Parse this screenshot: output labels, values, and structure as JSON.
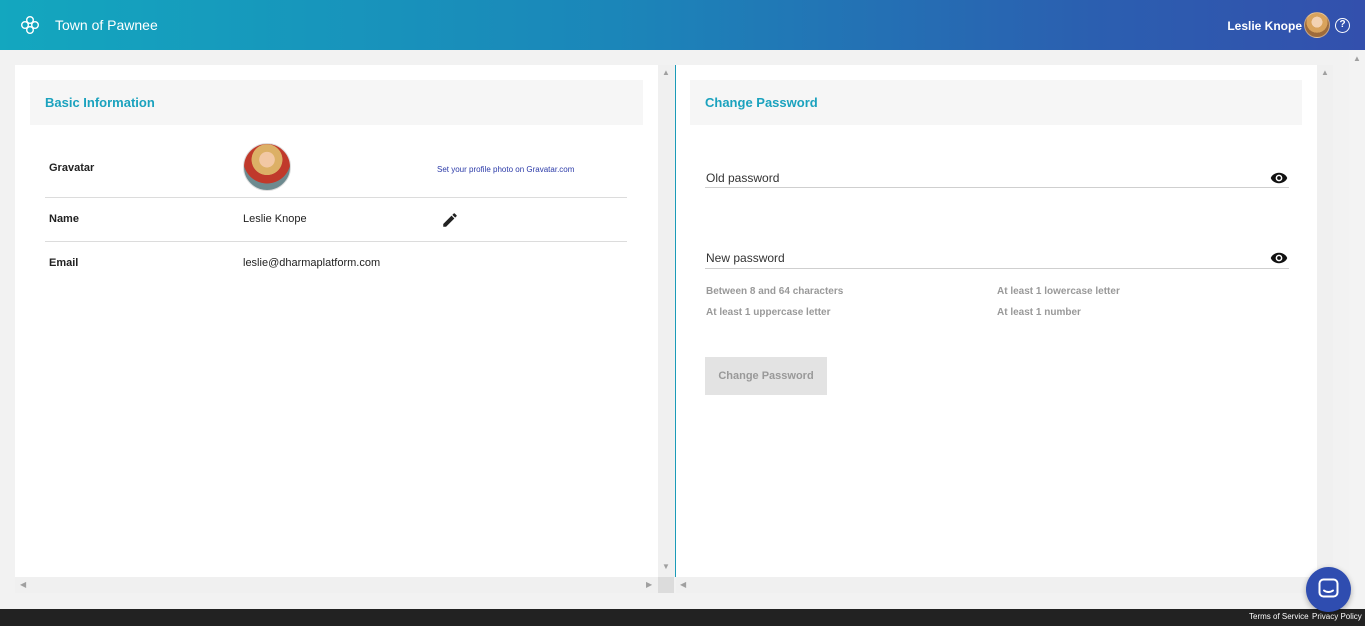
{
  "header": {
    "app_title": "Town of Pawnee",
    "user_name": "Leslie Knope",
    "help_symbol": "?",
    "logo_icon": "flower-logo-icon",
    "accent_gradient": [
      "#13a7bf",
      "#3350ad"
    ]
  },
  "basic_info": {
    "title": "Basic Information",
    "rows": [
      {
        "label": "Gravatar",
        "value": "",
        "action": "Set your profile photo on Gravatar.com"
      },
      {
        "label": "Name",
        "value": "Leslie Knope",
        "action_icon": "pencil-icon"
      },
      {
        "label": "Email",
        "value": "leslie@dharmaplatform.com"
      }
    ]
  },
  "change_password": {
    "title": "Change Password",
    "old_password_label": "Old password",
    "new_password_label": "New password",
    "requirements": [
      "Between 8 and 64 characters",
      "At least 1 lowercase letter",
      "At least 1 uppercase letter",
      "At least 1 number"
    ],
    "button_label": "Change Password"
  },
  "footer": {
    "terms": "Terms of Service",
    "privacy": "Privacy Policy"
  },
  "colors": {
    "accent": "#1ba2be",
    "chat_button": "#2f4db0"
  }
}
